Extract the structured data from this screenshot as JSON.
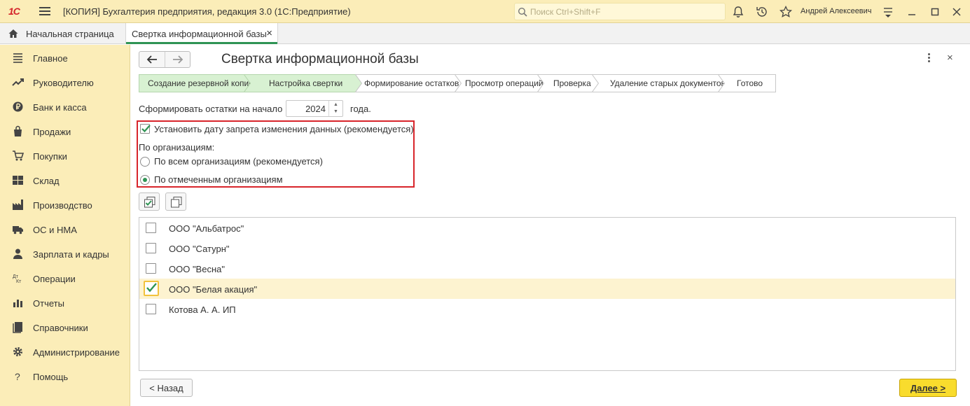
{
  "titlebar": {
    "logo": "1С",
    "app_title": "[КОПИЯ] Бухгалтерия предприятия, редакция 3.0  (1С:Предприятие)",
    "search_placeholder": "Поиск Ctrl+Shift+F",
    "user_name": "Андрей Алексеевич",
    "icons": [
      "bell-icon",
      "history-icon",
      "star-icon",
      "settings-menu-icon",
      "minimize-icon",
      "maximize-icon",
      "close-icon"
    ]
  },
  "tabs": {
    "home": "Начальная страница",
    "active": "Свертка информационной базы",
    "close_glyph": "×"
  },
  "sidebar": {
    "items": [
      {
        "label": "Главное",
        "icon": "main-menu-icon"
      },
      {
        "label": "Руководителю",
        "icon": "chart-line-icon"
      },
      {
        "label": "Банк и касса",
        "icon": "coin-icon"
      },
      {
        "label": "Продажи",
        "icon": "shopping-bag-icon"
      },
      {
        "label": "Покупки",
        "icon": "shopping-cart-icon"
      },
      {
        "label": "Склад",
        "icon": "warehouse-icon"
      },
      {
        "label": "Производство",
        "icon": "factory-icon"
      },
      {
        "label": "ОС и НМА",
        "icon": "truck-icon"
      },
      {
        "label": "Зарплата и кадры",
        "icon": "person-icon"
      },
      {
        "label": "Операции",
        "icon": "debit-credit-icon"
      },
      {
        "label": "Отчеты",
        "icon": "bar-chart-icon"
      },
      {
        "label": "Справочники",
        "icon": "book-icon"
      },
      {
        "label": "Администрирование",
        "icon": "gear-icon"
      },
      {
        "label": "Помощь",
        "icon": "question-icon"
      }
    ]
  },
  "form": {
    "title": "Свертка информационной базы",
    "steps": [
      {
        "label": "Создание резервной копии",
        "done": true
      },
      {
        "label": "Настройка свертки",
        "done": true
      },
      {
        "label": "Формирование остатков",
        "done": false
      },
      {
        "label": "Просмотр операций",
        "done": false
      },
      {
        "label": "Проверка",
        "done": false
      },
      {
        "label": "Удаление старых документов",
        "done": false
      },
      {
        "label": "Готово",
        "done": false
      }
    ],
    "balances_label": "Сформировать остатки на начало",
    "year_value": "2024",
    "year_suffix": "года.",
    "lock_date_checkbox": {
      "label": "Установить дату запрета изменения данных (рекомендуется)",
      "checked": true
    },
    "by_org_label": "По организациям:",
    "radio_all": {
      "label": "По всем организациям (рекомендуется)",
      "selected": false
    },
    "radio_marked": {
      "label": "По отмеченным организациям",
      "selected": true
    },
    "organizations": [
      {
        "name": "ООО \"Альбатрос\"",
        "checked": false
      },
      {
        "name": "ООО \"Сатурн\"",
        "checked": false
      },
      {
        "name": "ООО \"Весна\"",
        "checked": false
      },
      {
        "name": "ООО \"Белая акация\"",
        "checked": true
      },
      {
        "name": "Котова А. А. ИП",
        "checked": false
      }
    ],
    "back_button": "< Назад",
    "next_button": "Далее >"
  },
  "colors": {
    "accent_green": "#2f9454",
    "titlebar_yellow": "#fbedb8",
    "step_done": "#d8f1d2",
    "highlight_row": "#fdf3d0",
    "primary_button": "#f9dc2d",
    "annotation_red": "#d8252b"
  }
}
